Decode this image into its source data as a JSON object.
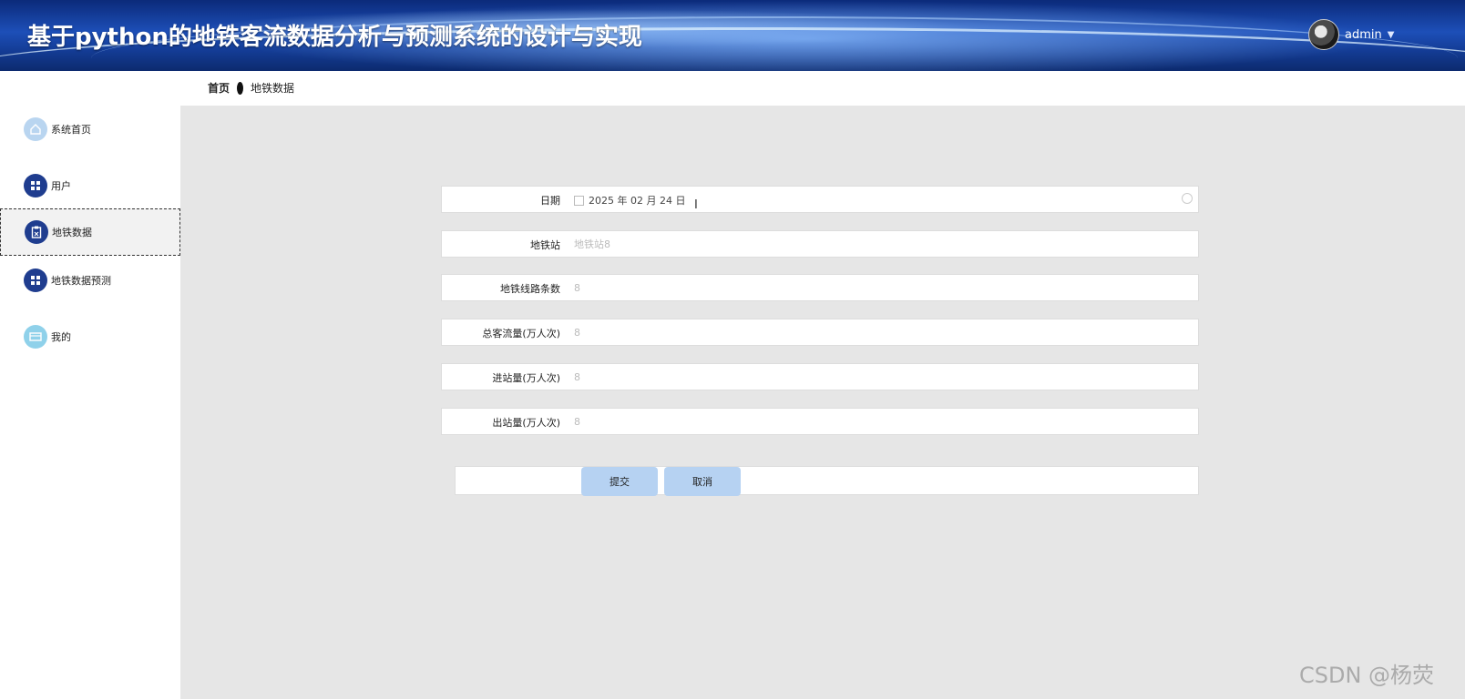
{
  "header": {
    "title": "基于python的地铁客流数据分析与预测系统的设计与实现",
    "username": "admin",
    "avatar_icon": "user-avatar",
    "colors": {
      "primary": "#1d4fb8",
      "dark": "#0b2a7a"
    }
  },
  "breadcrumb": {
    "home": "首页",
    "current": "地铁数据"
  },
  "sidebar": {
    "items": [
      {
        "label": "系统首页",
        "icon": "home-icon"
      },
      {
        "label": "用户",
        "icon": "grid-icon"
      },
      {
        "label": "地铁数据",
        "icon": "clipboard-icon",
        "active": true
      },
      {
        "label": "地铁数据预测",
        "icon": "grid-icon"
      },
      {
        "label": "我的",
        "icon": "card-icon"
      }
    ]
  },
  "form": {
    "date": {
      "label": "日期",
      "value": "2025 年 02 月 24 日"
    },
    "station": {
      "label": "地铁站",
      "placeholder": "地铁站8"
    },
    "lines": {
      "label": "地铁线路条数",
      "placeholder": "8"
    },
    "total_flow": {
      "label": "总客流量(万人次)",
      "placeholder": "8"
    },
    "inbound": {
      "label": "进站量(万人次)",
      "placeholder": "8"
    },
    "outbound": {
      "label": "出站量(万人次)",
      "placeholder": "8"
    },
    "submit_label": "提交",
    "cancel_label": "取消"
  },
  "watermark": "CSDN @杨荧"
}
